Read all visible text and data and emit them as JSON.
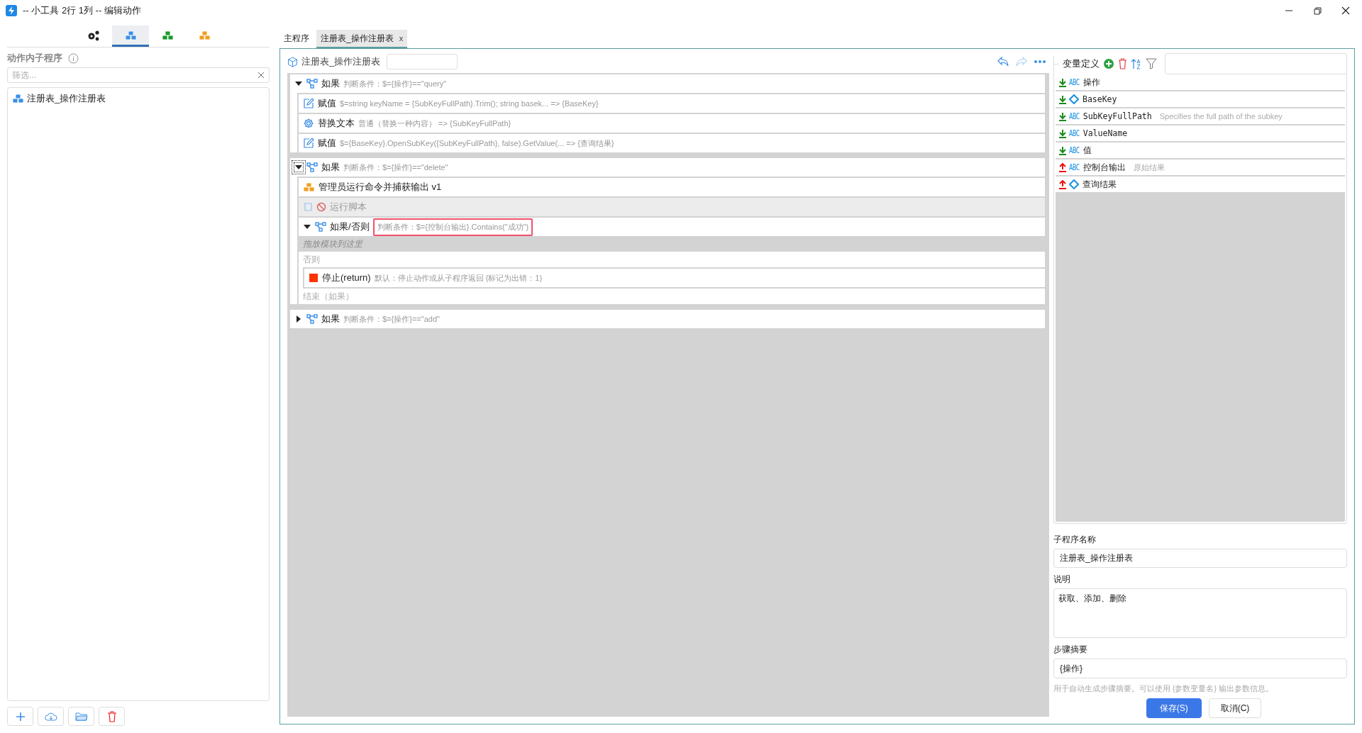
{
  "window": {
    "title": "-- 小工具 2行 1列 -- 编辑动作"
  },
  "left_tabs": [
    {
      "kind": "gears",
      "selected": false
    },
    {
      "kind": "blue-cubes",
      "selected": true
    },
    {
      "kind": "green-cubes",
      "selected": false
    },
    {
      "kind": "orange-cubes",
      "selected": false
    }
  ],
  "left_panel": {
    "label": "动作内子程序",
    "filter": {
      "placeholder": "筛选..."
    },
    "items": [
      {
        "label": "注册表_操作注册表"
      }
    ]
  },
  "editor_tabs": [
    {
      "label": "主程序",
      "selected": false
    },
    {
      "label": "注册表_操作注册表",
      "selected": true,
      "close": "x"
    }
  ],
  "editor": {
    "title": "注册表_操作注册表",
    "steps": [
      {
        "kind": "if",
        "label": "如果",
        "detail": "判断条件：$={操作}==\"query\"",
        "expanded": true,
        "focused": false,
        "children": [
          {
            "kind": "assign",
            "label": "赋值",
            "detail": "$=string keyName = {SubKeyFullPath}.Trim();  string basek... => {BaseKey}"
          },
          {
            "kind": "replace",
            "label": "替换文本",
            "detail": "普通（替换一种内容）  => {SubKeyFullPath}"
          },
          {
            "kind": "assign",
            "label": "赋值",
            "detail": "$={BaseKey}.OpenSubKey({SubKeyFullPath}, false).GetValue(... => {查询结果}"
          }
        ]
      },
      {
        "kind": "if",
        "label": "如果",
        "detail": "判断条件：$={操作}==\"delete\"",
        "expanded": true,
        "focused": true,
        "children": [
          {
            "kind": "subroutine",
            "label": "管理员运行命令并捕获输出 v1",
            "disabled": false
          },
          {
            "kind": "script",
            "label": "运行脚本",
            "disabled": true
          },
          {
            "kind": "ifelse",
            "label": "如果/否则",
            "detail": "判断条件：$={控制台输出}.Contains(\"成功\")",
            "highlighted": true,
            "expanded": true,
            "drop_hint": "拖放模块到这里",
            "else_label": "否则",
            "else_children": [
              {
                "kind": "stop",
                "label": "停止(return)",
                "detail": "默认：停止动作或从子程序返回 (标记为出错：1)"
              }
            ],
            "end_label": "结束（如果）"
          }
        ]
      },
      {
        "kind": "if",
        "label": "如果",
        "detail": "判断条件：$={操作}==\"add\"",
        "expanded": false,
        "focused": false
      }
    ]
  },
  "variables": {
    "title": "变量定义",
    "items": [
      {
        "output": false,
        "kind": "text",
        "badge": "ABC",
        "name": "操作"
      },
      {
        "output": false,
        "kind": "object",
        "name": "BaseKey"
      },
      {
        "output": false,
        "kind": "text",
        "badge": "ABC",
        "name": "SubKeyFullPath",
        "description": "Specifies the full path of the subkey"
      },
      {
        "output": false,
        "kind": "text",
        "badge": "ABC",
        "name": "ValueName"
      },
      {
        "output": false,
        "kind": "text",
        "badge": "ABC",
        "name": "值"
      },
      {
        "output": true,
        "kind": "text",
        "badge": "ABC",
        "name": "控制台输出",
        "description": "原始结果"
      },
      {
        "output": true,
        "kind": "object",
        "name": "查询结果"
      }
    ]
  },
  "properties": {
    "name_label": "子程序名称",
    "name_value": "注册表_操作注册表",
    "description_label": "说明",
    "description_value": "获取、添加、删除",
    "summary_label": "步骤摘要",
    "summary_value": "{操作}",
    "summary_hint": "用于自动生成步骤摘要。可以使用 {参数变量名} 输出参数信息。"
  },
  "buttons": [
    {
      "kind": "primary",
      "label": "保存(S)"
    },
    {
      "kind": "secondary",
      "label": "取消(C)"
    }
  ]
}
